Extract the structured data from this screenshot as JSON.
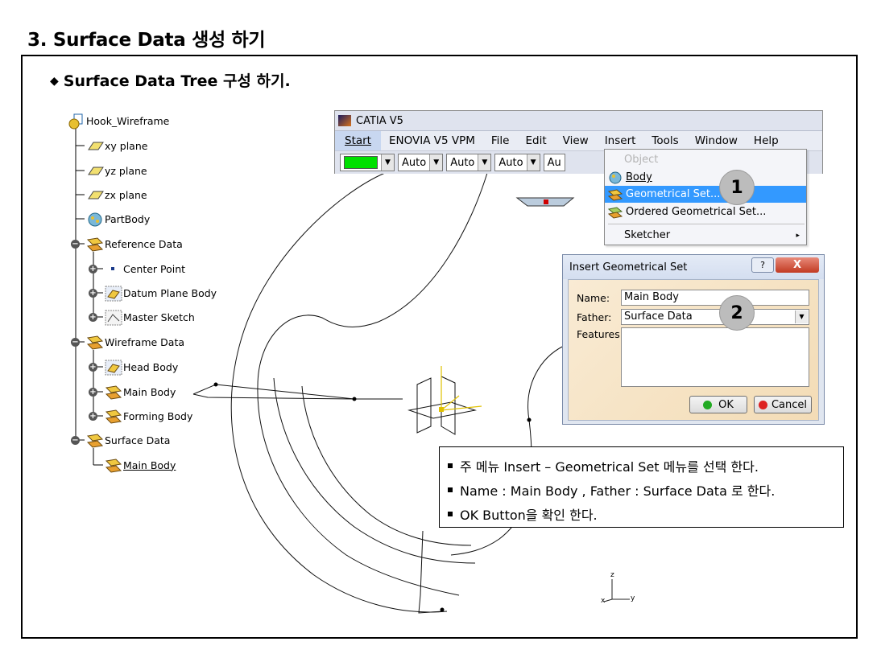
{
  "slide": {
    "title": "3. Surface Data 생성 하기",
    "subtitle_marker": "◆",
    "subtitle": "Surface Data Tree 구성 하기."
  },
  "tree": {
    "root": "Hook_Wireframe",
    "items": [
      {
        "label": "xy plane",
        "icon": "plane-icon"
      },
      {
        "label": "yz plane",
        "icon": "plane-icon"
      },
      {
        "label": "zx plane",
        "icon": "plane-icon"
      },
      {
        "label": "PartBody",
        "icon": "partbody-icon"
      },
      {
        "label": "Reference Data",
        "icon": "geometrical-set-icon"
      },
      {
        "label": "Center Point",
        "icon": "point-icon"
      },
      {
        "label": "Datum Plane Body",
        "icon": "datum-body-icon"
      },
      {
        "label": "Master Sketch",
        "icon": "sketch-body-icon"
      },
      {
        "label": "Wireframe Data",
        "icon": "geometrical-set-icon"
      },
      {
        "label": "Head Body",
        "icon": "datum-body-icon"
      },
      {
        "label": "Main Body",
        "icon": "geometrical-set-icon"
      },
      {
        "label": "Forming Body",
        "icon": "geometrical-set-icon"
      },
      {
        "label": "Surface Data",
        "icon": "geometrical-set-icon"
      },
      {
        "label": "Main Body",
        "icon": "geometrical-set-icon"
      }
    ]
  },
  "catia": {
    "title": "CATIA V5",
    "menu": [
      "Start",
      "ENOVIA V5 VPM",
      "File",
      "Edit",
      "View",
      "Insert",
      "Tools",
      "Window",
      "Help"
    ],
    "toolbar": {
      "color": "#00e000",
      "combos": [
        "Auto",
        "Auto",
        "Auto",
        "Au"
      ]
    }
  },
  "insert_menu": {
    "items": [
      {
        "label": "Object",
        "state": "disabled"
      },
      {
        "label": "Body",
        "state": "normal"
      },
      {
        "label": "Geometrical Set...",
        "state": "highlighted"
      },
      {
        "label": "Ordered Geometrical Set...",
        "state": "normal"
      },
      {
        "label": "Sketcher",
        "state": "submenu"
      }
    ],
    "submenu_arrow": "▸"
  },
  "badges": [
    "1",
    "2"
  ],
  "dialog": {
    "title": "Insert Geometrical Set",
    "help": "?",
    "close": "X",
    "name_label": "Name:",
    "name_value": "Main Body",
    "father_label": "Father:",
    "father_value": "Surface Data",
    "features_label": "Features:",
    "ok_label": "OK",
    "cancel_label": "Cancel"
  },
  "note": {
    "lines": [
      "주 메뉴 Insert – Geometrical Set 메뉴를 선택 한다.",
      "Name : Main Body , Father : Surface Data 로 한다.",
      "OK Button을 확인 한다."
    ]
  },
  "axis": {
    "z": "z",
    "y": "y",
    "x": "x"
  },
  "colors": {
    "highlight": "#3399ff",
    "dialog_body": "#f6e4c4",
    "ok_dot": "#22aa22",
    "cancel_dot": "#dd2222"
  }
}
